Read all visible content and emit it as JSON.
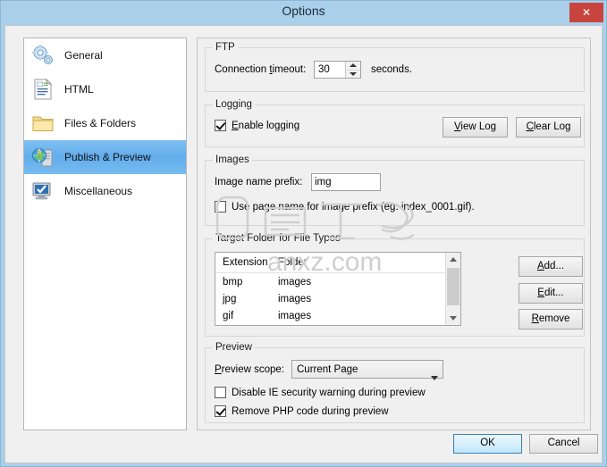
{
  "window": {
    "title": "Options",
    "close_label": "✕"
  },
  "sidebar": {
    "items": [
      {
        "label": "General",
        "icon": "gears-icon",
        "selected": false
      },
      {
        "label": "HTML",
        "icon": "document-icon",
        "selected": false
      },
      {
        "label": "Files & Folders",
        "icon": "folder-icon",
        "selected": false
      },
      {
        "label": "Publish & Preview",
        "icon": "publish-icon",
        "selected": true
      },
      {
        "label": "Miscellaneous",
        "icon": "monitor-icon",
        "selected": false
      }
    ],
    "selected_index": 3
  },
  "ftp": {
    "group_title": "FTP",
    "timeout_label_pre": "Connection ",
    "timeout_label_accel": "t",
    "timeout_label_post": "imeout:",
    "timeout_value": "30",
    "seconds_label": "seconds."
  },
  "logging": {
    "group_title": "Logging",
    "enable_label_pre": "",
    "enable_label_accel": "E",
    "enable_label_post": "nable logging",
    "enable_checked": true,
    "view_log_accel": "V",
    "view_log_post": "iew Log",
    "clear_log_accel": "C",
    "clear_log_post": "lear Log"
  },
  "images": {
    "group_title": "Images",
    "prefix_label": "Image name prefix:",
    "prefix_value": "img",
    "prefix_placeholder": "",
    "use_page_name_label": "Use page name for image prefix (eg. index_0001.gif).",
    "use_page_name_checked": false
  },
  "target_folder": {
    "group_title": "Target Folder for File Types",
    "columns": [
      "Extension",
      "Folder"
    ],
    "rows": [
      {
        "extension": "bmp",
        "folder": "images"
      },
      {
        "extension": "jpg",
        "folder": "images"
      },
      {
        "extension": "gif",
        "folder": "images"
      }
    ],
    "buttons": [
      {
        "accel": "A",
        "rest": "dd...",
        "name": "add-button"
      },
      {
        "accel": "E",
        "rest": "dit...",
        "name": "edit-button"
      },
      {
        "accel": "R",
        "rest": "emove",
        "name": "remove-button"
      }
    ]
  },
  "preview": {
    "group_title": "Preview",
    "scope_label_accel": "P",
    "scope_label_post": "review scope:",
    "scope_value": "Current Page",
    "scope_options": [
      "Current Page"
    ],
    "disable_ie_label": "Disable IE security warning during preview",
    "disable_ie_checked": false,
    "remove_php_label": "Remove PHP code during preview",
    "remove_php_checked": true
  },
  "footer": {
    "ok_label": "OK",
    "cancel_label": "Cancel"
  },
  "watermark": {
    "text": "anxz.com"
  },
  "colors": {
    "titlebar": "#a9cfea",
    "close_button": "#c7443f",
    "selection": "#62adec",
    "panel_bg": "#f0f0f0",
    "default_button_border": "#3c7fb1"
  }
}
